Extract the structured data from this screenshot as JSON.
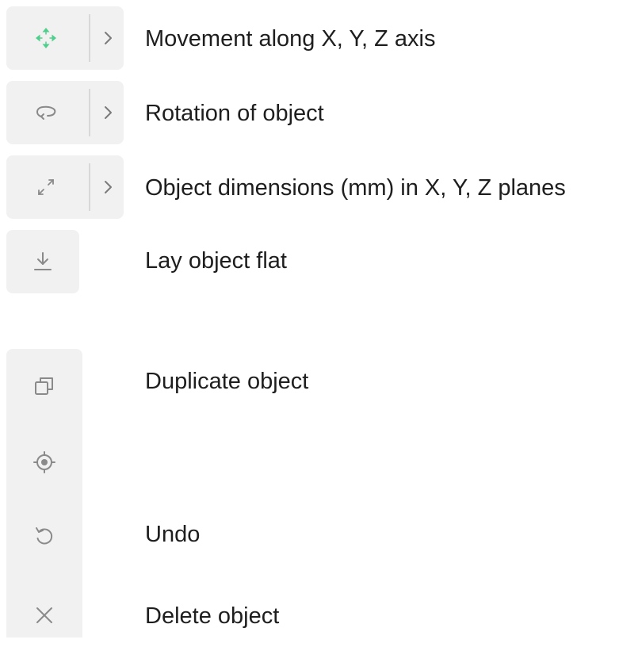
{
  "tools": {
    "move": {
      "label": "Movement along X, Y, Z axis",
      "icon": "move-arrows-icon"
    },
    "rotate": {
      "label": "Rotation of object",
      "icon": "rotate-icon"
    },
    "scale": {
      "label": "Object dimensions (mm) in X, Y, Z planes",
      "icon": "scale-arrows-icon"
    },
    "lay_flat": {
      "label": "Lay object flat",
      "icon": "lay-flat-icon"
    }
  },
  "actions": {
    "duplicate": {
      "label": "Duplicate object",
      "icon": "duplicate-icon"
    },
    "center": {
      "label": "",
      "icon": "target-icon"
    },
    "undo": {
      "label": "Undo",
      "icon": "undo-icon"
    },
    "delete": {
      "label": "Delete object",
      "icon": "close-icon"
    }
  },
  "colors": {
    "accent": "#4fcf8c",
    "icon": "#8a8a8a",
    "panel": "#f1f1f1",
    "text": "#1e1e1e"
  }
}
